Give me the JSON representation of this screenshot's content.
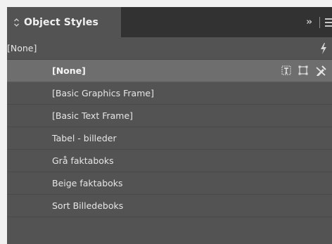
{
  "panel": {
    "tab": {
      "title": "Object Styles",
      "chevron_icon": "up-down-chevron-icon"
    },
    "tabbar_controls": {
      "collapse_label": "››",
      "menu_icon": "panel-menu-icon"
    },
    "current_style": {
      "label": "[None]",
      "icon": "lightning-icon"
    },
    "styles": [
      {
        "label": "[None]",
        "selected": true,
        "icons": [
          "text-frame-icon",
          "graphic-frame-icon",
          "no-edit-pencil-icon"
        ]
      },
      {
        "label": "[Basic Graphics Frame]",
        "selected": false
      },
      {
        "label": "[Basic Text Frame]",
        "selected": false
      },
      {
        "label": "Tabel - billeder",
        "selected": false
      },
      {
        "label": "Grå faktaboks",
        "selected": false
      },
      {
        "label": "Beige faktaboks",
        "selected": false
      },
      {
        "label": "Sort Billedeboks",
        "selected": false
      }
    ]
  },
  "colors": {
    "panel_bg": "#535353",
    "tabbar_bg": "#323232",
    "selected_row_bg": "#6e6e6e",
    "text": "#e6e6e6"
  }
}
